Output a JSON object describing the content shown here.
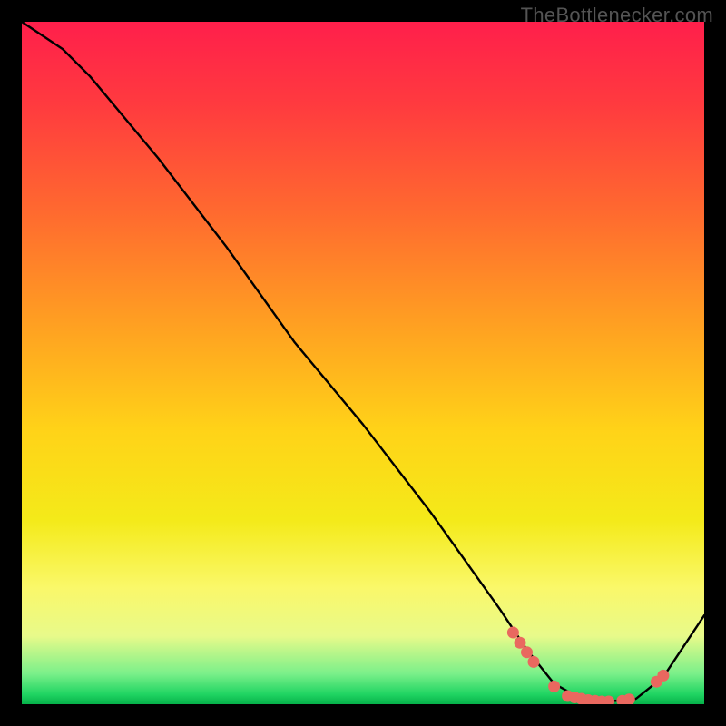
{
  "watermark": "TheBottlenecker.com",
  "chart_data": {
    "type": "line",
    "title": "",
    "xlabel": "",
    "ylabel": "",
    "xlim": [
      0,
      100
    ],
    "ylim": [
      0,
      100
    ],
    "series": [
      {
        "name": "curve",
        "x": [
          0,
          6,
          10,
          20,
          30,
          40,
          50,
          60,
          70,
          74,
          78,
          82,
          86,
          90,
          94,
          100
        ],
        "y": [
          100,
          96,
          92,
          80,
          67,
          53,
          41,
          28,
          14,
          8,
          3,
          0.8,
          0.4,
          0.8,
          4,
          13
        ]
      }
    ],
    "markers": {
      "name": "highlight-points",
      "color": "#e9685f",
      "x": [
        72,
        73,
        74,
        75,
        78,
        80,
        81,
        82,
        83,
        84,
        85,
        86,
        88,
        89,
        93,
        94
      ],
      "y": [
        10.5,
        9.0,
        7.6,
        6.2,
        2.6,
        1.2,
        1.0,
        0.8,
        0.6,
        0.5,
        0.4,
        0.4,
        0.5,
        0.7,
        3.3,
        4.2
      ]
    },
    "gradient_stops": [
      {
        "offset": 0.0,
        "color": "#ff1f4b"
      },
      {
        "offset": 0.12,
        "color": "#ff3a3f"
      },
      {
        "offset": 0.28,
        "color": "#ff6a2f"
      },
      {
        "offset": 0.45,
        "color": "#ffa221"
      },
      {
        "offset": 0.6,
        "color": "#ffd318"
      },
      {
        "offset": 0.73,
        "color": "#f4ea19"
      },
      {
        "offset": 0.83,
        "color": "#faf86a"
      },
      {
        "offset": 0.9,
        "color": "#e8fa8a"
      },
      {
        "offset": 0.955,
        "color": "#7bf08a"
      },
      {
        "offset": 0.985,
        "color": "#21d563"
      },
      {
        "offset": 1.0,
        "color": "#06b24a"
      }
    ]
  }
}
